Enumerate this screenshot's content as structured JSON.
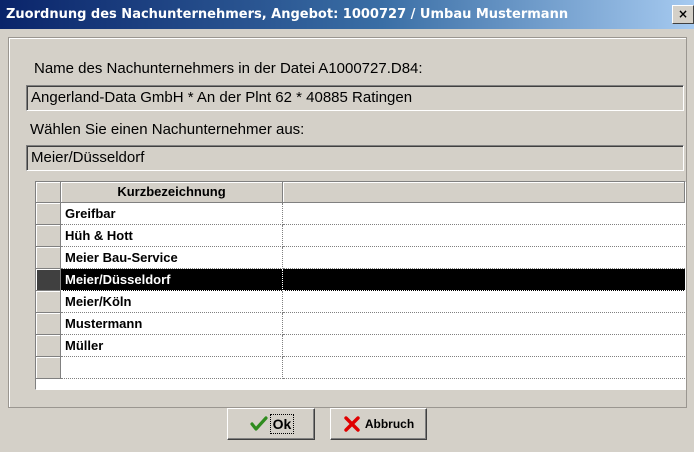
{
  "window": {
    "title": "Zuordnung des Nachunternehmers, Angebot: 1000727 / Umbau Mustermann",
    "close_glyph": "×"
  },
  "file_section": {
    "label": "Name des Nachunternehmers in der Datei A1000727.D84:",
    "value": "Angerland-Data GmbH * An der Plnt 62 * 40885 Ratingen"
  },
  "choose_section": {
    "label": "Wählen Sie einen Nachunternehmer aus:",
    "value": "Meier/Düsseldorf"
  },
  "grid": {
    "column_header": "Kurzbezeichnung",
    "rows": [
      {
        "name": "Greifbar",
        "selected": false
      },
      {
        "name": "Hüh & Hott",
        "selected": false
      },
      {
        "name": "Meier Bau-Service",
        "selected": false
      },
      {
        "name": "Meier/Düsseldorf",
        "selected": true
      },
      {
        "name": "Meier/Köln",
        "selected": false
      },
      {
        "name": "Mustermann",
        "selected": false
      },
      {
        "name": "Müller",
        "selected": false
      },
      {
        "name": "",
        "selected": false
      }
    ]
  },
  "buttons": {
    "ok_label": "Ok",
    "cancel_label": "Abbruch",
    "ok_icon": "checkmark-icon",
    "cancel_icon": "red-x-icon"
  },
  "colors": {
    "title_gradient_start": "#0a246a",
    "title_gradient_end": "#a6caf0",
    "face": "#d4d0c8",
    "selection": "#000000",
    "ok_icon_color": "#2e8b1e",
    "cancel_icon_color": "#e00000"
  }
}
